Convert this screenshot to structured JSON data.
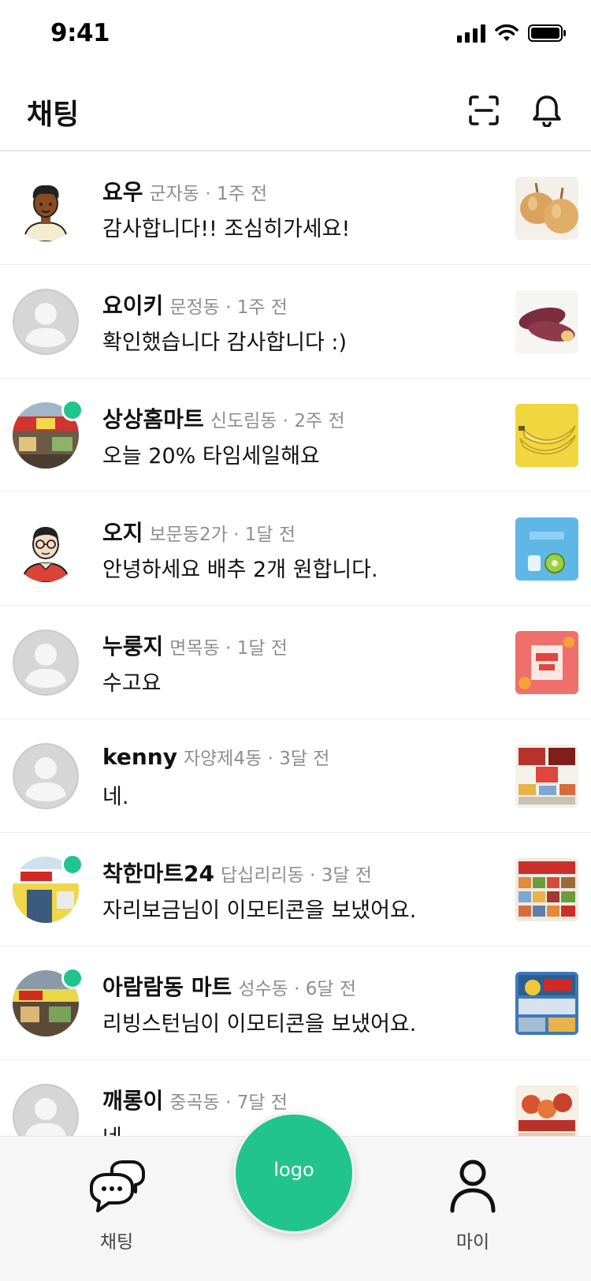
{
  "status_bar": {
    "time": "9:41"
  },
  "header": {
    "title": "채팅",
    "actions": [
      {
        "icon": "scan-icon"
      },
      {
        "icon": "bell-icon"
      }
    ]
  },
  "chats": [
    {
      "name": "요우",
      "meta": "군자동 · 1주 전",
      "message": "감사합니다!! 조심히가세요!",
      "avatar": "illustrated-man-avatar",
      "online": false,
      "thumbnail": "onions-thumbnail"
    },
    {
      "name": "요이키",
      "meta": "문정동 · 1주 전",
      "message": "확인했습니다 감사합니다 :)",
      "avatar": "default-avatar",
      "online": false,
      "thumbnail": "sweet-potato-thumbnail"
    },
    {
      "name": "상상홈마트",
      "meta": "신도림동 · 2주 전",
      "message": "오늘 20% 타임세일해요",
      "avatar": "store-front-avatar",
      "online": true,
      "thumbnail": "banana-thumbnail"
    },
    {
      "name": "오지",
      "meta": "보문동2가 · 1달 전",
      "message": "안녕하세요 배추 2개 원합니다.",
      "avatar": "illustrated-glasses-man-avatar",
      "online": false,
      "thumbnail": "big-sale-thumbnail"
    },
    {
      "name": "누룽지",
      "meta": "면목동 · 1달 전",
      "message": "수고요",
      "avatar": "default-avatar",
      "online": false,
      "thumbnail": "sale-50-off-thumbnail"
    },
    {
      "name": "kenny",
      "meta": "자양제4동 · 3달 전",
      "message": "네.",
      "avatar": "default-avatar",
      "online": false,
      "thumbnail": "flyer-thumbnail"
    },
    {
      "name": "착한마트24",
      "meta": "답십리리동 · 3달 전",
      "message": "자리보금님이 이모티콘을 보냈어요.",
      "avatar": "store-front-avatar",
      "online": true,
      "thumbnail": "flyer-thumbnail"
    },
    {
      "name": "아람람동 마트",
      "meta": "성수동 · 6달 전",
      "message": "리빙스턴님이 이모티콘을 보냈어요.",
      "avatar": "store-front-avatar",
      "online": true,
      "thumbnail": "flyer-thumbnail"
    },
    {
      "name": "깨롱이",
      "meta": "중곡동 · 7달 전",
      "message": "네.",
      "avatar": "default-avatar",
      "online": false,
      "thumbnail": "flyer-thumbnail"
    }
  ],
  "bottom_nav": {
    "chat_label": "채팅",
    "logo_label": "logo",
    "my_label": "마이"
  },
  "colors": {
    "accent": "#22c48e",
    "meta_text": "#8e8e8e",
    "nav_bg": "#f6f6f6"
  }
}
